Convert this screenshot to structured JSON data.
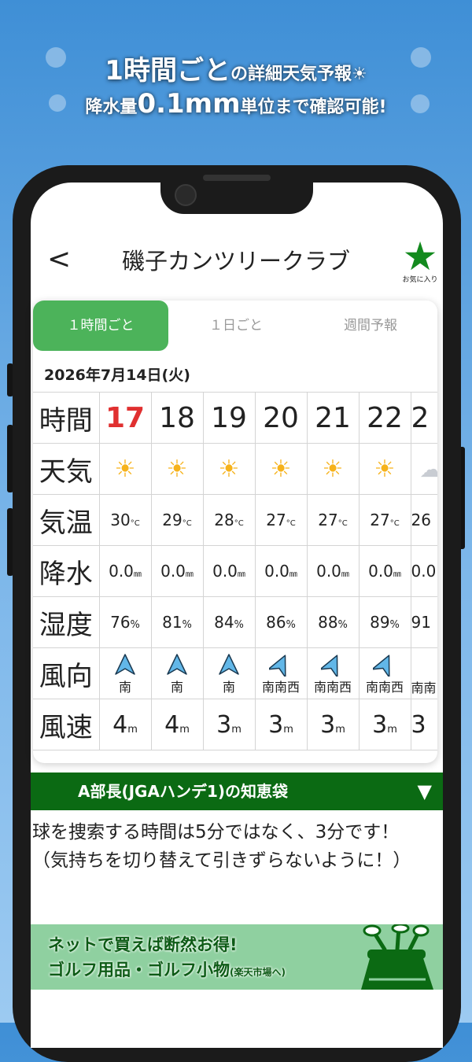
{
  "promo": {
    "line1_big": "1時間ごと",
    "line1_small": "の詳細天気予報☀",
    "line2_a": "降水量",
    "line2_big": "0.1mm",
    "line2_b": "単位まで確認可能!"
  },
  "nav": {
    "back_label": "<",
    "title": "磯子カンツリークラブ",
    "favorite_label": "お気に入り"
  },
  "tabs": [
    {
      "label": "１時間ごと",
      "active": true
    },
    {
      "label": "１日ごと",
      "active": false
    },
    {
      "label": "週間予報",
      "active": false
    }
  ],
  "date": "2026年7月14日(火)",
  "row_labels": {
    "time": "時間",
    "weather": "天気",
    "temp": "気温",
    "precip": "降水",
    "humidity": "湿度",
    "wind_dir": "風向",
    "wind_speed": "風速"
  },
  "units": {
    "temp": "°C",
    "precip": "㎜",
    "humidity": "%",
    "wind_speed": "m"
  },
  "hours": [
    {
      "time": "17",
      "weather": "sun-icon",
      "temp": "30",
      "precip": "0.0",
      "humidity": "76",
      "dir": "南",
      "speed": "4",
      "now": true
    },
    {
      "time": "18",
      "weather": "sun-icon",
      "temp": "29",
      "precip": "0.0",
      "humidity": "81",
      "dir": "南",
      "speed": "4"
    },
    {
      "time": "19",
      "weather": "sun-icon",
      "temp": "28",
      "precip": "0.0",
      "humidity": "84",
      "dir": "南",
      "speed": "3"
    },
    {
      "time": "20",
      "weather": "sun-icon",
      "temp": "27",
      "precip": "0.0",
      "humidity": "86",
      "dir": "南南西",
      "speed": "3"
    },
    {
      "time": "21",
      "weather": "sun-icon",
      "temp": "27",
      "precip": "0.0",
      "humidity": "88",
      "dir": "南南西",
      "speed": "3"
    },
    {
      "time": "22",
      "weather": "sun-icon",
      "temp": "27",
      "precip": "0.0",
      "humidity": "89",
      "dir": "南南西",
      "speed": "3"
    },
    {
      "time": "2",
      "weather": "cloud-icon",
      "temp": "26",
      "precip": "0.0",
      "humidity": "91",
      "dir": "南南",
      "speed": "3"
    }
  ],
  "tip": {
    "title": "A部長(JGAハンデ1)の知恵袋",
    "toggle": "▼",
    "text": "球を捜索する時間は5分ではなく、3分です！（気持ちを切り替えて引きずらないように！）"
  },
  "banner": {
    "line1": "ネットで買えば断然お得!",
    "line2": "ゴルフ用品・ゴルフ小物",
    "line2_small": "(楽天市場へ)"
  },
  "colors": {
    "accent_green": "#4cb35a",
    "dark_green": "#0b6a13",
    "now_red": "#e03030",
    "arrow_blue": "#62b7e8"
  }
}
